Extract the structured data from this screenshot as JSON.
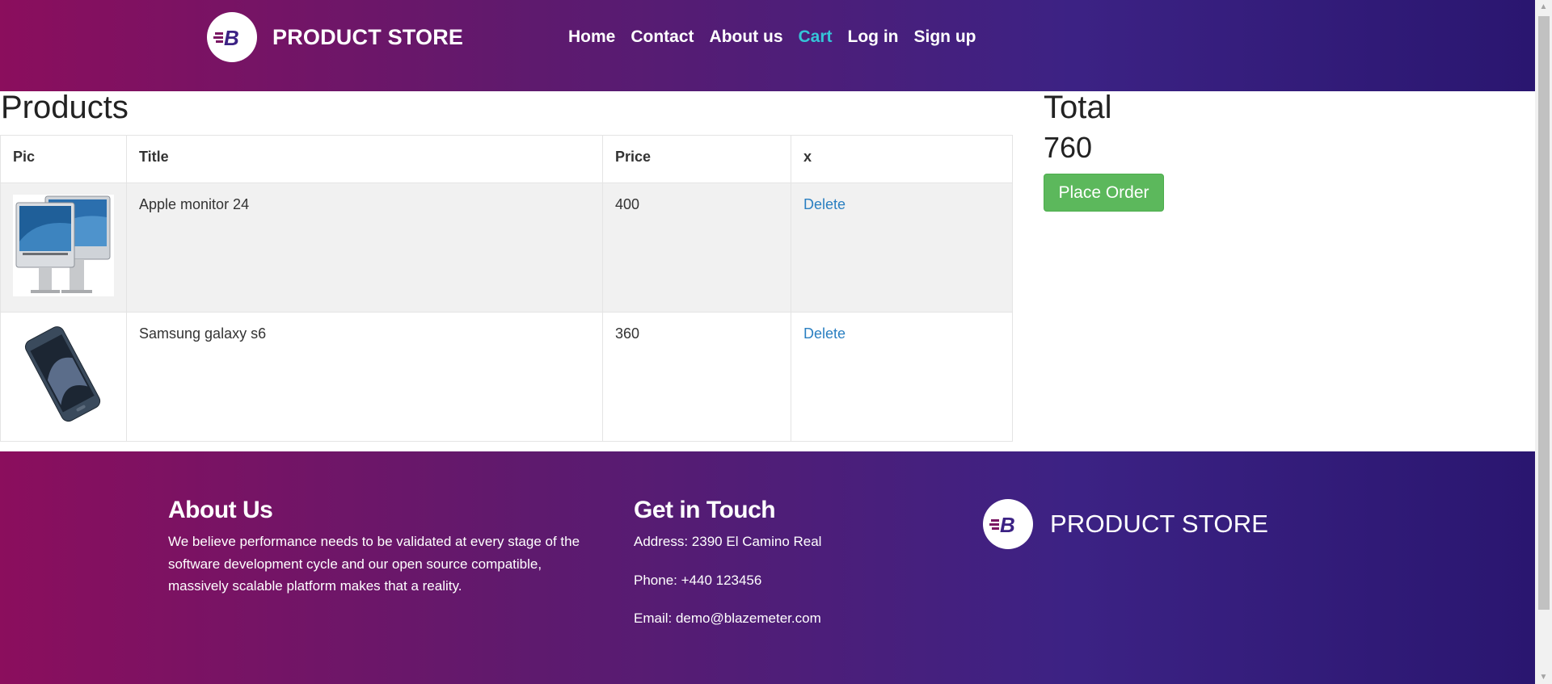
{
  "nav": {
    "brand": "PRODUCT STORE",
    "links": [
      {
        "label": "Home",
        "active": false
      },
      {
        "label": "Contact",
        "active": false
      },
      {
        "label": "About us",
        "active": false
      },
      {
        "label": "Cart",
        "active": true
      },
      {
        "label": "Log in",
        "active": false
      },
      {
        "label": "Sign up",
        "active": false
      }
    ],
    "active_color": "#35c5d8"
  },
  "products": {
    "title": "Products",
    "headers": [
      "Pic",
      "Title",
      "Price",
      "x"
    ],
    "rows": [
      {
        "pic": "apple-monitor-image",
        "title": "Apple monitor 24",
        "price": "400",
        "action": "Delete"
      },
      {
        "pic": "samsung-phone-image",
        "title": "Samsung galaxy s6",
        "price": "360",
        "action": "Delete"
      }
    ]
  },
  "total": {
    "title": "Total",
    "value": "760",
    "button": "Place Order"
  },
  "footer": {
    "about_title": "About Us",
    "about_text": "We believe performance needs to be validated at every stage of the software development cycle and our open source compatible, massively scalable platform makes that a reality.",
    "touch_title": "Get in Touch",
    "address": "Address: 2390 El Camino Real",
    "phone": "Phone: +440 123456",
    "email": "Email: demo@blazemeter.com",
    "brand": "PRODUCT STORE"
  },
  "colors": {
    "gradient_start": "#8b0e5d",
    "gradient_end": "#2a1670",
    "button": "#5cb85c",
    "link": "#2a7fc1"
  }
}
